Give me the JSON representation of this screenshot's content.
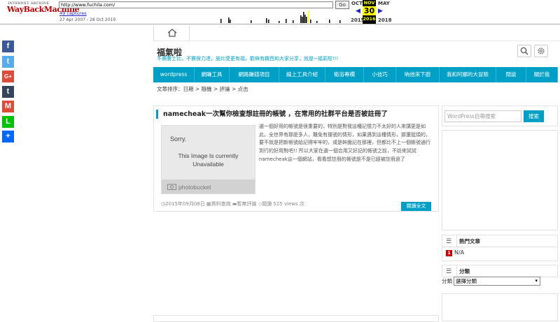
{
  "wayback": {
    "logo_top": "INTERNET ARCHIVE",
    "logo_main": "WayBackMachine",
    "url": "http://www.fuchila.com/",
    "go_label": "Go",
    "captures": "49 captures",
    "dates": "27 Apr 2007 - 28 Oct 2019",
    "prev_month": "OCT",
    "cur_month": "NOV",
    "next_month": "MAY",
    "prev_year": "2015",
    "cur_year": "2016",
    "next_year": "2018",
    "cur_day": "30"
  },
  "share": [
    {
      "icon": "facebook-icon",
      "glyph": "f",
      "color": "#3b5998"
    },
    {
      "icon": "twitter-icon",
      "glyph": "t",
      "color": "#55acee"
    },
    {
      "icon": "google-plus-icon",
      "glyph": "G+",
      "color": "#dd4b39"
    },
    {
      "icon": "tumblr-icon",
      "glyph": "t",
      "color": "#35465c"
    },
    {
      "icon": "gmail-icon",
      "glyph": "M",
      "color": "#dd4b39"
    },
    {
      "icon": "line-icon",
      "glyph": "L",
      "color": "#00c300"
    },
    {
      "icon": "share-plus-icon",
      "glyph": "+",
      "color": "#0166ff"
    }
  ],
  "site": {
    "title": "福氣啦",
    "description": "不賽勝士比，不賽保力達，施比受更有福，歡與有趣西和大家分享，就是~福氣啦!!!"
  },
  "nav": [
    "wordpress",
    "網賺工具",
    "網路賺錢項目",
    "線上工具介紹",
    "衛浴專欄",
    "小技巧",
    "吶他來下廚",
    "我和阿娜的大冒險",
    "閒談",
    "關於我"
  ],
  "sort": {
    "label": "文章排序：",
    "options": "日期 > 隨機 > 評論 > 点击"
  },
  "post": {
    "title": "namecheak一次幫你檢查想註冊的帳號 ，在常用的社群平台是否被註冊了",
    "image_sorry": "Sorry.",
    "image_line1": "This Image Is currently",
    "image_line2": "Unavailable",
    "image_brand": "photobucket",
    "excerpt": "選一個好用的帳號是很重要的，特別是對我這種記憶力不太好的人來講更是如此。全世界有那麼多人，難免有撞號的情形，如果遇到這種情形，那還挺煩的，要不就是把新帳號給記得牢牢的，或是幹脆記在那裡，但都比不上一個帳號通行到行的好用對吧!! 所以大家在選一個合用又好記的帳號之前，不妨來試試namecheak這一個網站，看看想註冊的帳號是不是已經被註冊過了",
    "date": "2015年09月08日",
    "category": "資料查詢",
    "comments": "暫無評論",
    "views": "閱讀 525 views 次",
    "read_more": "閱讀全文"
  },
  "sidebar": {
    "search_placeholder": "WordPress自帶搜索",
    "search_button": "搜索",
    "popular_title": "熱門文章",
    "popular_rank": "1",
    "popular_item": "N/A",
    "categories_title": "分類",
    "categories_label": "分類",
    "categories_select": "選擇分類"
  }
}
